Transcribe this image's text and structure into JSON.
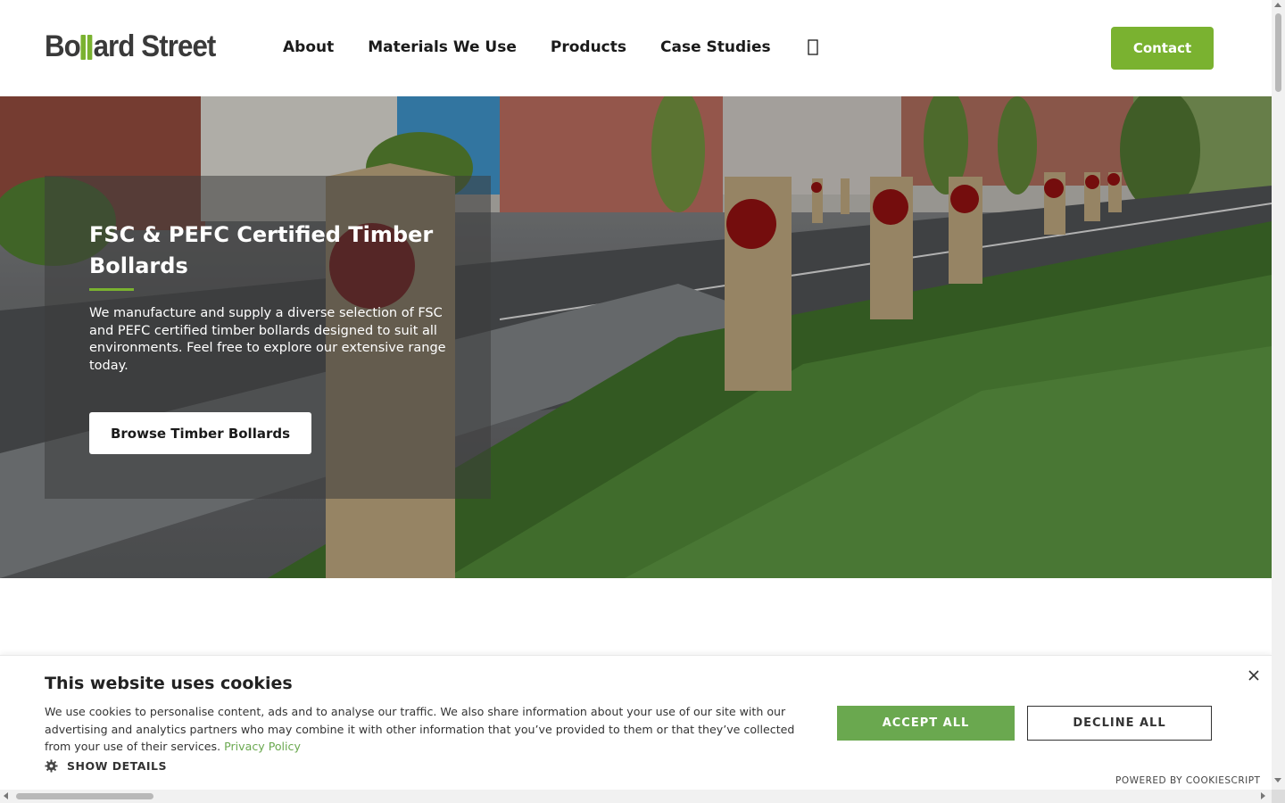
{
  "header": {
    "logo_text_before": "Bo",
    "logo_text_after": "ard Street",
    "nav": [
      {
        "label": "About"
      },
      {
        "label": "Materials We Use"
      },
      {
        "label": "Products"
      },
      {
        "label": "Case Studies"
      }
    ],
    "search_icon": "search-icon",
    "contact_label": "Contact"
  },
  "hero": {
    "title": "FSC & PEFC Certified Timber Bollards",
    "text": "We manufacture and supply a diverse selection of FSC and PEFC certified timber bollards designed to suit all environments. Feel free to explore our extensive range today.",
    "button_label": "Browse Timber Bollards"
  },
  "cookie": {
    "title": "This website uses cookies",
    "text": "We use cookies to personalise content, ads and to analyse our traffic. We also share information about your use of our site with our advertising and analytics partners who may combine it with other information that you’ve provided to them or that they’ve collected from your use of their services.",
    "privacy_link": "Privacy Policy",
    "show_details": "SHOW DETAILS",
    "accept_label": "ACCEPT ALL",
    "decline_label": "DECLINE ALL",
    "powered_by": "POWERED BY COOKIESCRIPT"
  },
  "colors": {
    "brand_green": "#7ab230",
    "cookie_green": "#6aa84f"
  }
}
